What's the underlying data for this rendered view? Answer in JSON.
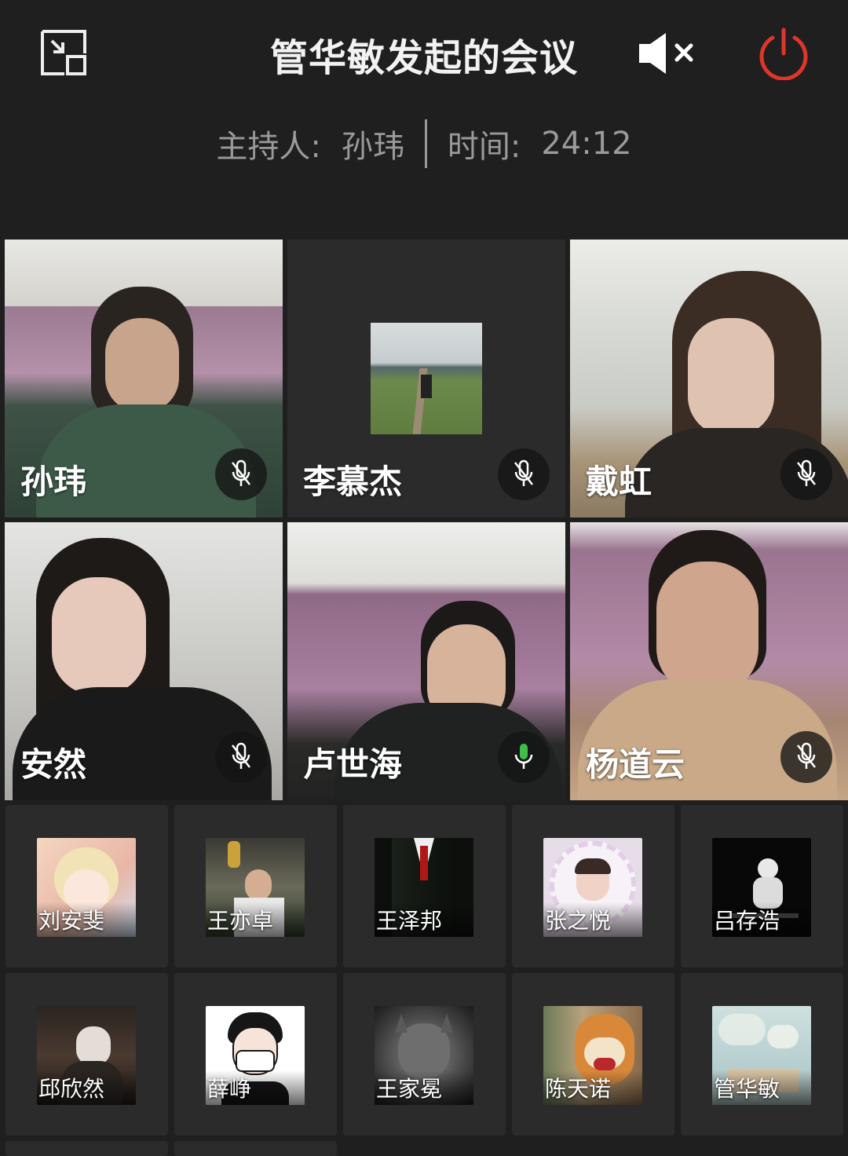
{
  "header": {
    "title": "管华敏发起的会议",
    "host_label": "主持人:",
    "host_name": "孙玮",
    "time_label": "时间:",
    "time_value": "24:12"
  },
  "colors": {
    "background": "#1f1f1f",
    "power_red": "#e0352b",
    "mic_active_green": "#3dbf4a",
    "subtext_gray": "#9a9a9a"
  },
  "video_participants": [
    {
      "name": "孙玮",
      "mic": "muted"
    },
    {
      "name": "李慕杰",
      "mic": "muted"
    },
    {
      "name": "戴虹",
      "mic": "muted"
    },
    {
      "name": "安然",
      "mic": "muted"
    },
    {
      "name": "卢世海",
      "mic": "speaking"
    },
    {
      "name": "杨道云",
      "mic": "muted"
    }
  ],
  "avatar_participants": [
    {
      "name": "刘安斐"
    },
    {
      "name": "王亦卓"
    },
    {
      "name": "王泽邦"
    },
    {
      "name": "张之悦"
    },
    {
      "name": "吕存浩"
    },
    {
      "name": "邱欣然"
    },
    {
      "name": "薛峥"
    },
    {
      "name": "王家冕"
    },
    {
      "name": "陈天诺"
    },
    {
      "name": "管华敏"
    }
  ],
  "icons": {
    "collapse": "exit-fullscreen-icon",
    "speaker": "speaker-muted-icon",
    "power": "power-icon",
    "mic_muted": "mic-off-icon",
    "mic_active": "mic-on-icon"
  }
}
